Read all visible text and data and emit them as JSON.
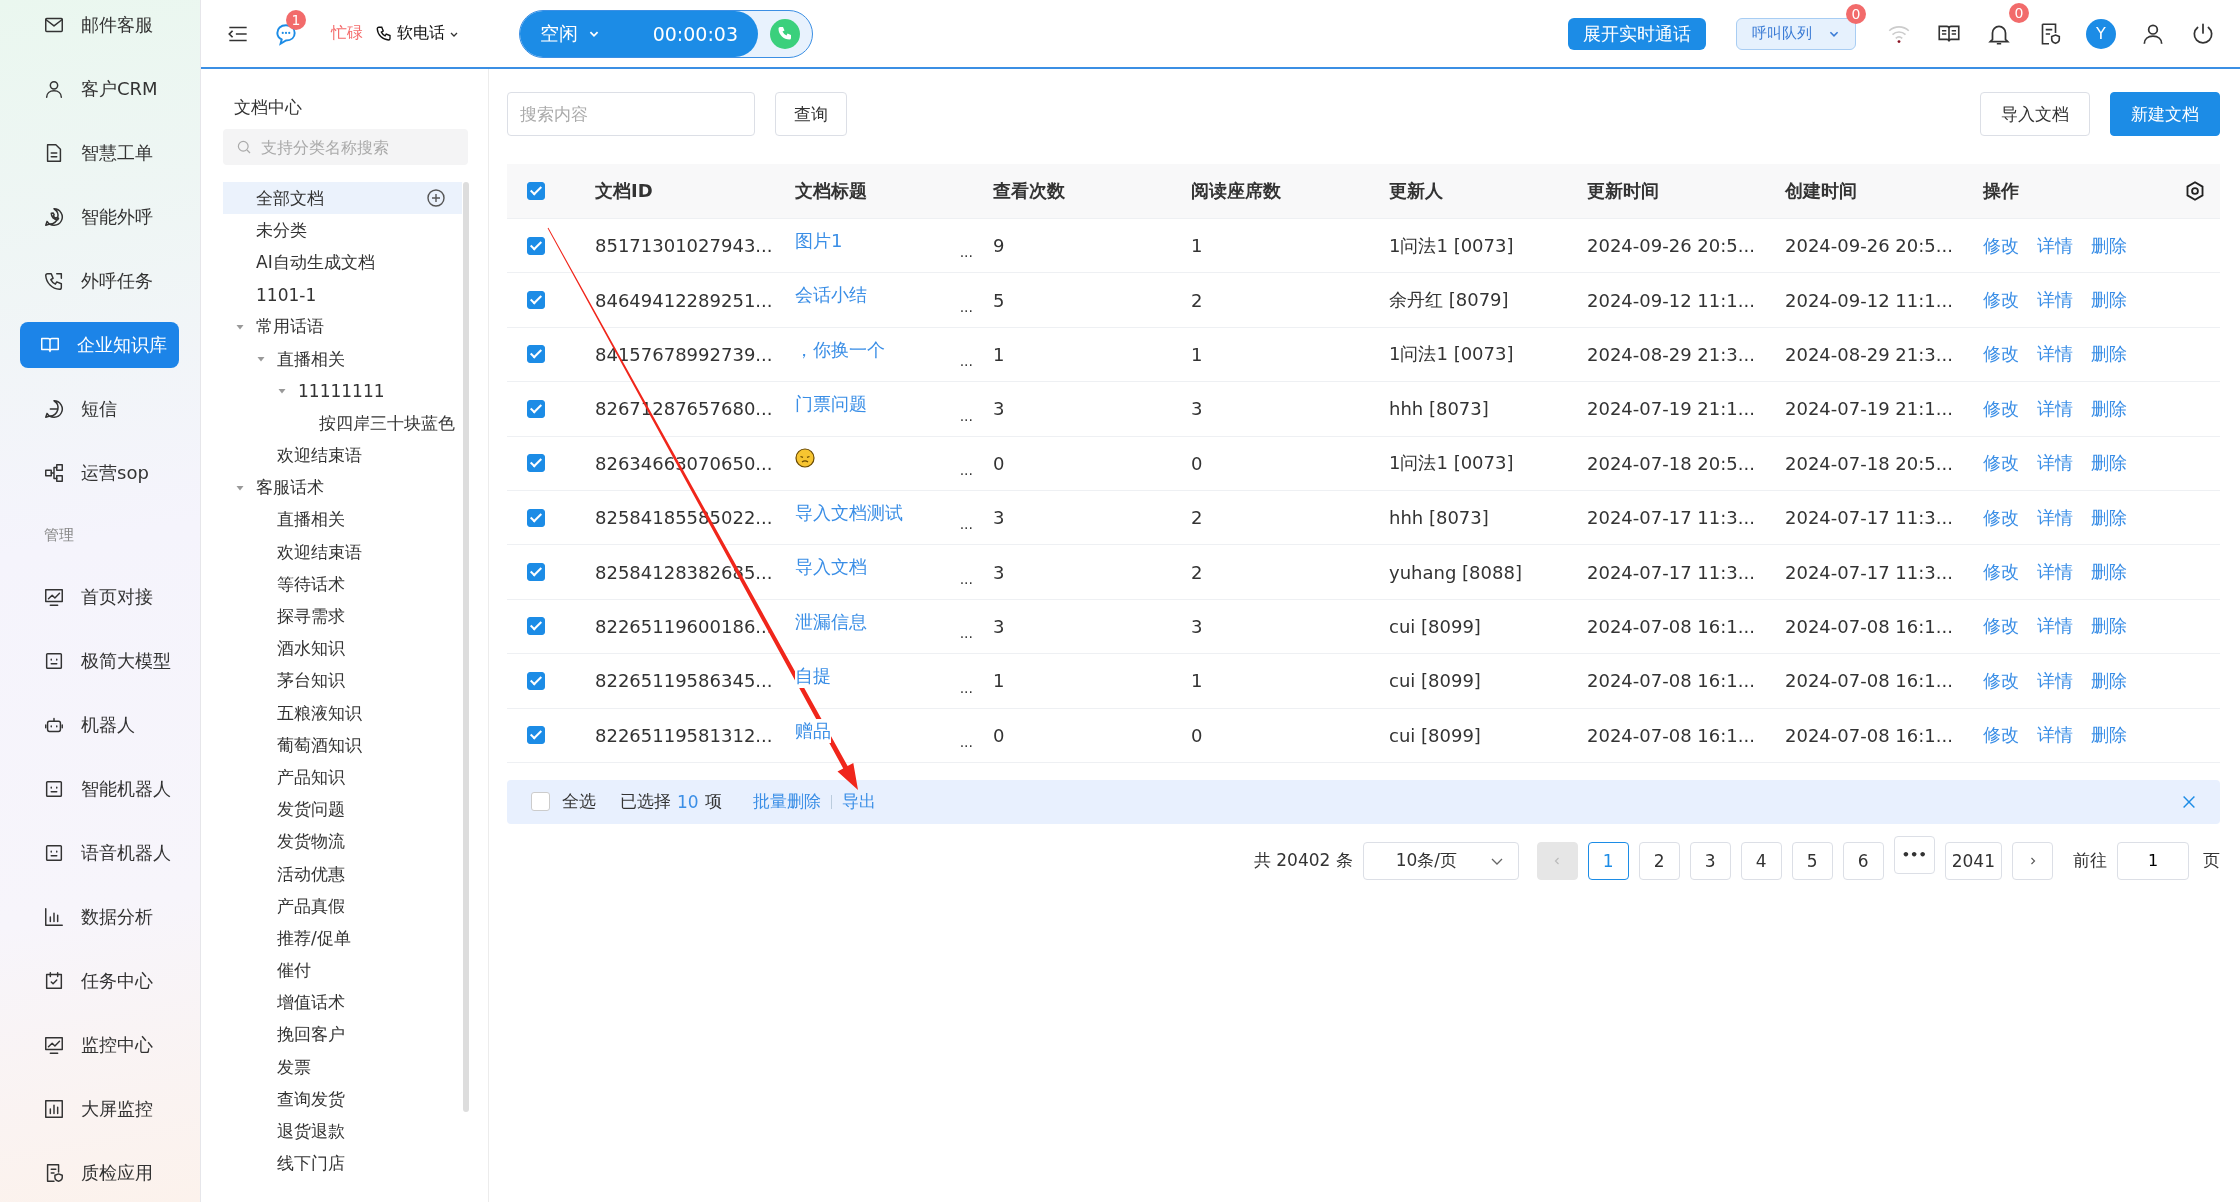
{
  "nav": {
    "items": [
      {
        "kind": "link",
        "label": "邮件客服",
        "selected": false
      },
      {
        "kind": "link",
        "label": "客户CRM",
        "selected": false
      },
      {
        "kind": "link",
        "label": "智慧工单",
        "selected": false
      },
      {
        "kind": "link",
        "label": "智能外呼",
        "selected": false
      },
      {
        "kind": "link",
        "label": "外呼任务",
        "selected": false
      },
      {
        "kind": "link",
        "label": "企业知识库",
        "selected": true
      },
      {
        "kind": "link",
        "label": "短信",
        "selected": false
      },
      {
        "kind": "link",
        "label": "运营sop",
        "selected": false
      },
      {
        "kind": "section",
        "label": "管理"
      },
      {
        "kind": "link",
        "label": "首页对接",
        "selected": false
      },
      {
        "kind": "link",
        "label": "极简大模型",
        "selected": false
      },
      {
        "kind": "link",
        "label": "机器人",
        "selected": false
      },
      {
        "kind": "link",
        "label": "智能机器人",
        "selected": false
      },
      {
        "kind": "link",
        "label": "语音机器人",
        "selected": false
      },
      {
        "kind": "link",
        "label": "数据分析",
        "selected": false
      },
      {
        "kind": "link",
        "label": "任务中心",
        "selected": false
      },
      {
        "kind": "link",
        "label": "监控中心",
        "selected": false
      },
      {
        "kind": "link",
        "label": "大屏监控",
        "selected": false
      },
      {
        "kind": "link",
        "label": "质检应用",
        "selected": false
      }
    ]
  },
  "topbar": {
    "chat_badge": "1",
    "busy_label": "忙碌",
    "phone_label": "软电话",
    "status": "空闲",
    "timer": "00:00:03",
    "live_button": "展开实时通话",
    "queue": "呼叫队列",
    "queue_badge": "0",
    "bell_badge": "0",
    "avatar": "Y"
  },
  "tree": {
    "title": "文档中心",
    "search_placeholder": "支持分类名称搜索",
    "items": [
      {
        "label": "全部文档",
        "selected": true
      },
      {
        "label": "未分类",
        "selected": false
      },
      {
        "label": "AI自动生成文档",
        "selected": false
      },
      {
        "label": "1101-1",
        "selected": false
      },
      {
        "label": "常用话语",
        "selected": false,
        "expanded": true,
        "children": [
          {
            "label": "直播相关",
            "selected": false,
            "expanded": true,
            "children": [
              {
                "label": "11111111",
                "selected": false,
                "expanded": true,
                "children": [
                  {
                    "label": "按四岸三十块蓝色",
                    "selected": false
                  }
                ]
              }
            ]
          },
          {
            "label": "欢迎结束语",
            "selected": false
          }
        ]
      },
      {
        "label": "客服话术",
        "selected": false,
        "expanded": true,
        "children": [
          {
            "label": "直播相关",
            "selected": false
          },
          {
            "label": "欢迎结束语",
            "selected": false
          },
          {
            "label": "等待话术",
            "selected": false
          },
          {
            "label": "探寻需求",
            "selected": false
          },
          {
            "label": "酒水知识",
            "selected": false
          },
          {
            "label": "茅台知识",
            "selected": false
          },
          {
            "label": "五粮液知识",
            "selected": false
          },
          {
            "label": "葡萄酒知识",
            "selected": false
          },
          {
            "label": "产品知识",
            "selected": false
          },
          {
            "label": "发货问题",
            "selected": false
          },
          {
            "label": "发货物流",
            "selected": false
          },
          {
            "label": "活动优惠",
            "selected": false
          },
          {
            "label": "产品真假",
            "selected": false
          },
          {
            "label": "推荐/促单",
            "selected": false
          },
          {
            "label": "催付",
            "selected": false
          },
          {
            "label": "增值话术",
            "selected": false
          },
          {
            "label": "挽回客户",
            "selected": false
          },
          {
            "label": "发票",
            "selected": false
          },
          {
            "label": "查询发货",
            "selected": false
          },
          {
            "label": "退货退款",
            "selected": false
          },
          {
            "label": "线下门店",
            "selected": false
          }
        ]
      }
    ]
  },
  "toolbar": {
    "search_placeholder": "搜索内容",
    "query_button": "查询",
    "import_button": "导入文档",
    "new_button": "新建文档"
  },
  "table": {
    "all_checked": true,
    "columns": [
      "文档ID",
      "文档标题",
      "查看次数",
      "阅读座席数",
      "更新人",
      "更新时间",
      "创建时间",
      "操作"
    ],
    "rows": [
      {
        "checked": true,
        "id": "85171301027943...",
        "kind": "text",
        "title": "图片1",
        "more": "...",
        "views": "9",
        "seats": "1",
        "updater": "1问法1 [0073]",
        "updated": "2024-09-26 20:5...",
        "created": "2024-09-26 20:5...",
        "actions": [
          "修改",
          "详情",
          "删除"
        ]
      },
      {
        "checked": true,
        "id": "84649412289251...",
        "kind": "text",
        "title": "会话小结",
        "more": "...",
        "views": "5",
        "seats": "2",
        "updater": "余丹红 [8079]",
        "updated": "2024-09-12 11:1...",
        "created": "2024-09-12 11:1...",
        "actions": [
          "修改",
          "详情",
          "删除"
        ]
      },
      {
        "checked": true,
        "id": "84157678992739...",
        "kind": "text",
        "title": "，你换一个",
        "more": "...",
        "views": "1",
        "seats": "1",
        "updater": "1问法1 [0073]",
        "updated": "2024-08-29 21:3...",
        "created": "2024-08-29 21:3...",
        "actions": [
          "修改",
          "详情",
          "删除"
        ]
      },
      {
        "checked": true,
        "id": "82671287657680...",
        "kind": "text",
        "title": "门票问题",
        "more": "...",
        "views": "3",
        "seats": "3",
        "updater": "hhh [8073]",
        "updated": "2024-07-19 21:1...",
        "created": "2024-07-19 21:1...",
        "actions": [
          "修改",
          "详情",
          "删除"
        ]
      },
      {
        "checked": true,
        "id": "82634663070650...",
        "kind": "emoji",
        "more": "...",
        "views": "0",
        "seats": "0",
        "updater": "1问法1 [0073]",
        "updated": "2024-07-18 20:5...",
        "created": "2024-07-18 20:5...",
        "actions": [
          "修改",
          "详情",
          "删除"
        ]
      },
      {
        "checked": true,
        "id": "82584185585022...",
        "kind": "text",
        "title": "导入文档测试",
        "more": "...",
        "views": "3",
        "seats": "2",
        "updater": "hhh [8073]",
        "updated": "2024-07-17 11:3...",
        "created": "2024-07-17 11:3...",
        "actions": [
          "修改",
          "详情",
          "删除"
        ]
      },
      {
        "checked": true,
        "id": "82584128382685...",
        "kind": "text",
        "title": "导入文档",
        "more": "...",
        "views": "3",
        "seats": "2",
        "updater": "yuhang [8088]",
        "updated": "2024-07-17 11:3...",
        "created": "2024-07-17 11:3...",
        "actions": [
          "修改",
          "详情",
          "删除"
        ]
      },
      {
        "checked": true,
        "id": "82265119600186...",
        "kind": "text",
        "title": "泄漏信息",
        "more": "...",
        "views": "3",
        "seats": "3",
        "updater": "cui [8099]",
        "updated": "2024-07-08 16:1...",
        "created": "2024-07-08 16:1...",
        "actions": [
          "修改",
          "详情",
          "删除"
        ]
      },
      {
        "checked": true,
        "id": "82265119586345...",
        "kind": "text",
        "title": "自提",
        "more": "...",
        "views": "1",
        "seats": "1",
        "updater": "cui [8099]",
        "updated": "2024-07-08 16:1...",
        "created": "2024-07-08 16:1...",
        "actions": [
          "修改",
          "详情",
          "删除"
        ]
      },
      {
        "checked": true,
        "id": "82265119581312...",
        "kind": "text",
        "title": "赠品",
        "more": "...",
        "views": "0",
        "seats": "0",
        "updater": "cui [8099]",
        "updated": "2024-07-08 16:1...",
        "created": "2024-07-08 16:1...",
        "actions": [
          "修改",
          "详情",
          "删除"
        ]
      }
    ]
  },
  "bulk_bar": {
    "select_all_checked": false,
    "select_all": "全选",
    "selected_prefix": "已选择",
    "selected_count": "10",
    "selected_suffix": "项",
    "batch_delete": "批量删除",
    "export": "导出"
  },
  "pagination": {
    "total": "共 20402 条",
    "page_size": "10条/页",
    "prev_disabled": true,
    "pages": [
      {
        "label": "1",
        "kind": "page",
        "selected": true
      },
      {
        "label": "2",
        "kind": "page",
        "selected": false
      },
      {
        "label": "3",
        "kind": "page",
        "selected": false
      },
      {
        "label": "4",
        "kind": "page",
        "selected": false
      },
      {
        "label": "5",
        "kind": "page",
        "selected": false
      },
      {
        "label": "6",
        "kind": "page",
        "selected": false
      },
      {
        "label": "•••",
        "kind": "more",
        "selected": false
      },
      {
        "label": "2041",
        "kind": "page",
        "selected": false
      }
    ],
    "goto_label": "前往",
    "goto_value": "1",
    "page_unit": "页"
  }
}
